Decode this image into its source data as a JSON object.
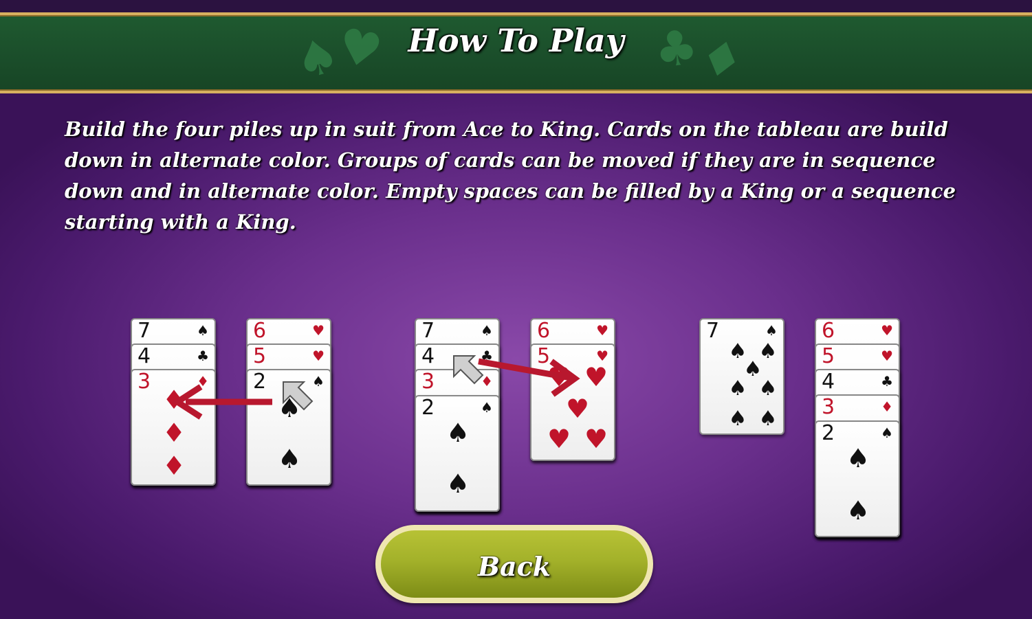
{
  "header": {
    "title": "How To Play"
  },
  "instructions": "Build the four piles up in suit from Ace to King. Cards on the tableau are build down in alternate color. Groups of cards can be moved if they are in sequence down and in alternate color. Empty spaces can be filled by a King or a sequence starting with a King.",
  "back_button": {
    "label": "Back"
  },
  "colors": {
    "banner": "#1b4f2b",
    "gold_trim": "#d7b060",
    "button": "#a3b12a",
    "red_suit": "#c0142a",
    "arrow": "#b8182e"
  },
  "examples": [
    {
      "name": "example-1",
      "piles": [
        {
          "cards": [
            {
              "rank": "7",
              "suit": "♠"
            },
            {
              "rank": "4",
              "suit": "♣"
            },
            {
              "rank": "3",
              "suit": "♦"
            }
          ]
        },
        {
          "cards": [
            {
              "rank": "6",
              "suit": "♥"
            },
            {
              "rank": "5",
              "suit": "♥"
            },
            {
              "rank": "2",
              "suit": "♠"
            }
          ]
        }
      ]
    },
    {
      "name": "example-2",
      "piles": [
        {
          "cards": [
            {
              "rank": "7",
              "suit": "♠"
            },
            {
              "rank": "4",
              "suit": "♣"
            },
            {
              "rank": "3",
              "suit": "♦"
            },
            {
              "rank": "2",
              "suit": "♠"
            }
          ]
        },
        {
          "cards": [
            {
              "rank": "6",
              "suit": "♥"
            },
            {
              "rank": "5",
              "suit": "♥"
            }
          ]
        }
      ]
    },
    {
      "name": "example-3",
      "piles": [
        {
          "cards": [
            {
              "rank": "7",
              "suit": "♠"
            }
          ]
        },
        {
          "cards": [
            {
              "rank": "6",
              "suit": "♥"
            },
            {
              "rank": "5",
              "suit": "♥"
            },
            {
              "rank": "4",
              "suit": "♣"
            },
            {
              "rank": "3",
              "suit": "♦"
            },
            {
              "rank": "2",
              "suit": "♠"
            }
          ]
        }
      ]
    }
  ]
}
